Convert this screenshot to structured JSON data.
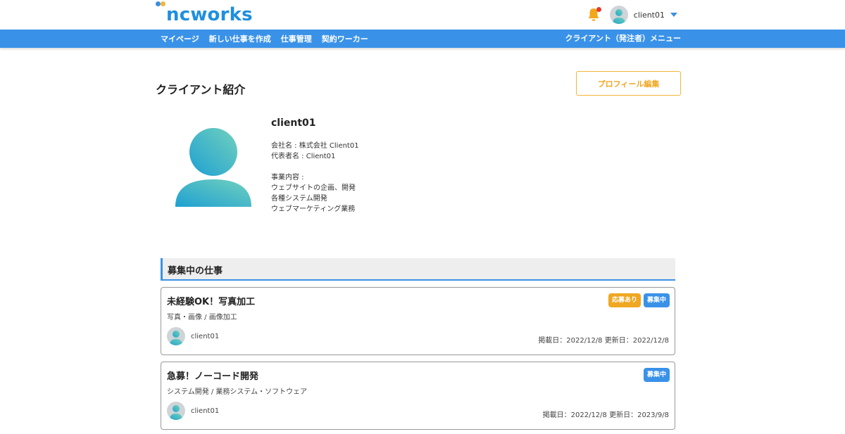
{
  "header": {
    "logo_text": "ncworks",
    "user_name": "client01",
    "logo_dot_colors": [
      "#3a8ee0",
      "#f2b53a"
    ]
  },
  "nav": {
    "items": [
      "マイページ",
      "新しい仕事を作成",
      "仕事管理",
      "契約ワーカー"
    ],
    "right_menu": "クライアント（発注者）メニュー"
  },
  "page": {
    "title": "クライアント紹介",
    "edit_button": "プロフィール編集"
  },
  "profile": {
    "name": "client01",
    "company_line": "会社名 : 株式会社 Client01",
    "representative_line": "代表者名 : Client01",
    "business_label": "事業内容 :",
    "business_items": [
      "ウェブサイトの企画、開発",
      "各種システム開発",
      "ウェブマーケティング業務"
    ]
  },
  "jobs_section": {
    "heading": "募集中の仕事",
    "jobs": [
      {
        "title": "未経験OK！写真加工",
        "category": "写真・画像 / 画像加工",
        "user": "client01",
        "dates": "掲載日：2022/12/8  更新日：2022/12/8",
        "badges": [
          {
            "label": "応募あり",
            "color": "#f0a721"
          },
          {
            "label": "募集中",
            "color": "#3a92e8"
          }
        ]
      },
      {
        "title": "急募！ノーコード開発",
        "category": "システム開発 / 業務システム・ソフトウェア",
        "user": "client01",
        "dates": "掲載日：2022/12/8  更新日：2023/9/8",
        "badges": [
          {
            "label": "募集中",
            "color": "#3a92e8"
          }
        ]
      }
    ]
  }
}
